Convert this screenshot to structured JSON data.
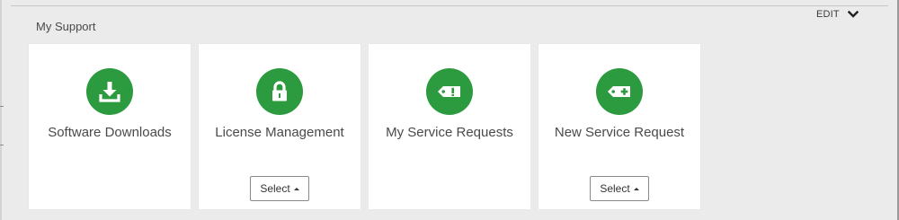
{
  "section": {
    "title": "My Support",
    "edit_label": "EDIT",
    "edit_icon": "chevron-down-icon"
  },
  "colors": {
    "icon_green": "#2c9a3e",
    "card_background": "#ffffff",
    "page_background": "#ebebeb"
  },
  "cards": [
    {
      "label": "Software Downloads",
      "icon": "download-icon"
    },
    {
      "label": "License Management",
      "icon": "lock-icon",
      "select_label": "Select"
    },
    {
      "label": "My Service Requests",
      "icon": "ticket-alert-icon"
    },
    {
      "label": "New Service Request",
      "icon": "ticket-add-icon",
      "select_label": "Select"
    }
  ]
}
